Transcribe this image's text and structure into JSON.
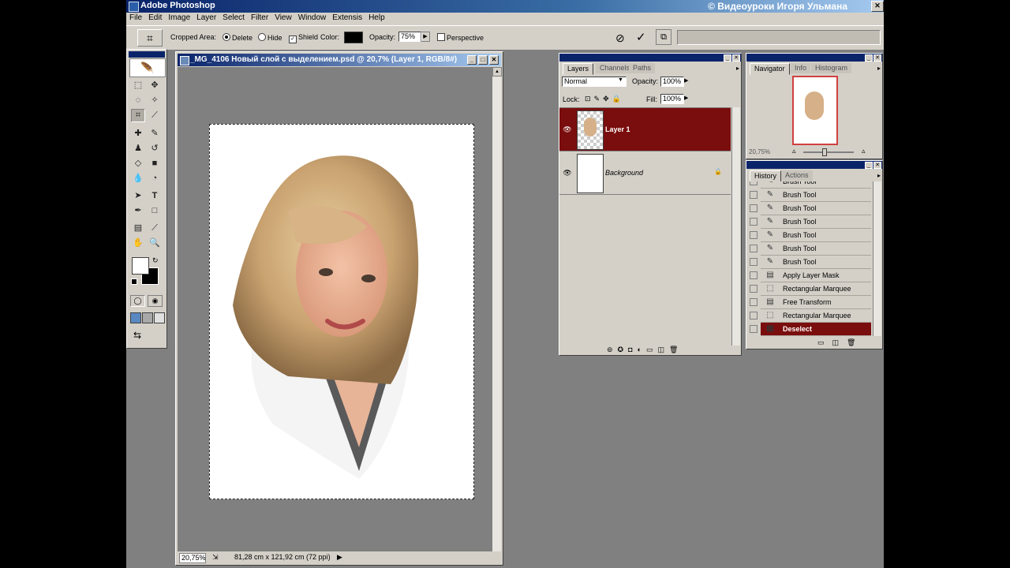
{
  "app": {
    "title": "Adobe Photoshop",
    "watermark": "© Видеоуроки Игоря Ульмана"
  },
  "menu": [
    "File",
    "Edit",
    "Image",
    "Layer",
    "Select",
    "Filter",
    "View",
    "Window",
    "Extensis",
    "Help"
  ],
  "options": {
    "cropped_area_label": "Cropped Area:",
    "delete_label": "Delete",
    "hide_label": "Hide",
    "shield_label": "Shield",
    "shield_checked": "✓",
    "color_label": "Color:",
    "opacity_label": "Opacity:",
    "opacity_value": "75%",
    "perspective_label": "Perspective",
    "shield_color": "#000000"
  },
  "document": {
    "title": "_MG_4106 Новый слой с выделением.psd @ 20,7% (Layer 1, RGB/8#)",
    "zoom": "20,75%",
    "size_info": "81,28 cm x 121,92 cm (72 ppi)"
  },
  "layers_panel": {
    "tabs": [
      "Layers",
      "Channels",
      "Paths"
    ],
    "blend_mode": "Normal",
    "opacity_label": "Opacity:",
    "opacity_value": "100%",
    "lock_label": "Lock:",
    "fill_label": "Fill:",
    "fill_value": "100%",
    "layers": [
      {
        "name": "Layer 1",
        "selected": true
      },
      {
        "name": "Background",
        "selected": false
      }
    ],
    "selected_color": "#7a0d0d"
  },
  "navigator_panel": {
    "tabs": [
      "Navigator",
      "Info",
      "Histogram"
    ],
    "zoom": "20,75%"
  },
  "history_panel": {
    "tabs": [
      "History",
      "Actions"
    ],
    "items": [
      {
        "label": "Brush Tool",
        "icon": "brush-icon"
      },
      {
        "label": "Brush Tool",
        "icon": "brush-icon"
      },
      {
        "label": "Brush Tool",
        "icon": "brush-icon"
      },
      {
        "label": "Brush Tool",
        "icon": "brush-icon"
      },
      {
        "label": "Brush Tool",
        "icon": "brush-icon"
      },
      {
        "label": "Brush Tool",
        "icon": "brush-icon"
      },
      {
        "label": "Brush Tool",
        "icon": "brush-icon"
      },
      {
        "label": "Apply Layer Mask",
        "icon": "document-icon"
      },
      {
        "label": "Rectangular Marquee",
        "icon": "marquee-icon"
      },
      {
        "label": "Free Transform",
        "icon": "document-icon"
      },
      {
        "label": "Rectangular Marquee",
        "icon": "marquee-icon"
      },
      {
        "label": "Deselect",
        "icon": "document-icon"
      }
    ]
  }
}
